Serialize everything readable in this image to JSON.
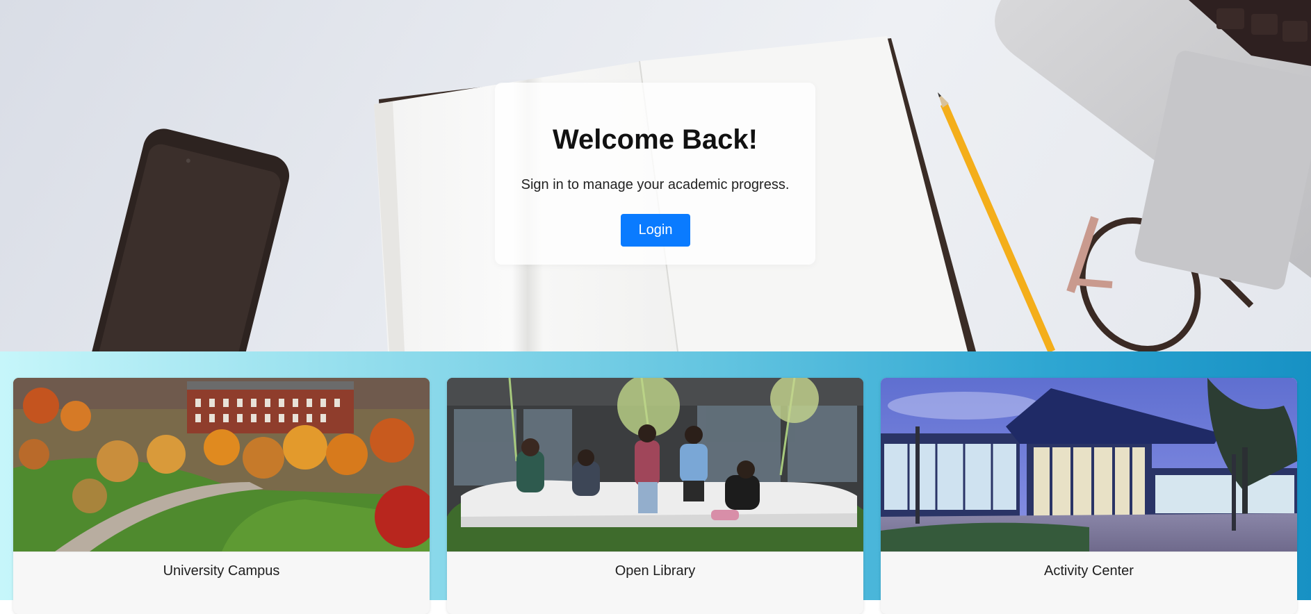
{
  "login": {
    "title": "Welcome Back!",
    "subtitle": "Sign in to manage your academic progress.",
    "button_label": "Login"
  },
  "gallery": {
    "cards": [
      {
        "title": "University Campus"
      },
      {
        "title": "Open Library"
      },
      {
        "title": "Activity Center"
      }
    ]
  },
  "colors": {
    "accent": "#0a7bff",
    "gallery_gradient_start": "#c6f6fa",
    "gallery_gradient_end": "#1791c4"
  }
}
